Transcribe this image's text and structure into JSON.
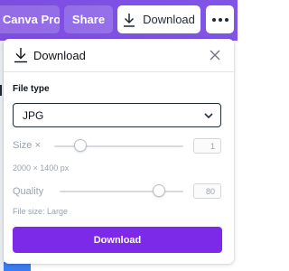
{
  "topbar": {
    "canva_pro_label": "Canva Pro",
    "share_label": "Share",
    "download_label": "Download",
    "more_icon": "more-dots-icon"
  },
  "panel": {
    "title": "Download",
    "header_icon": "download-icon",
    "close_icon": "close-icon",
    "file_type": {
      "label": "File type",
      "selected": "JPG",
      "chevron_icon": "chevron-down-icon"
    },
    "size": {
      "label": "Size ×",
      "value": "1",
      "level": 0.2,
      "dimensions": "2000 × 1400 px"
    },
    "quality": {
      "label": "Quality",
      "value": "80",
      "level": 0.8,
      "file_size": "File size: Large"
    },
    "download_button_label": "Download"
  },
  "colors": {
    "topbar": "#7d4de0",
    "accent": "#7d2ae8",
    "muted_text": "#9aa3ad"
  }
}
